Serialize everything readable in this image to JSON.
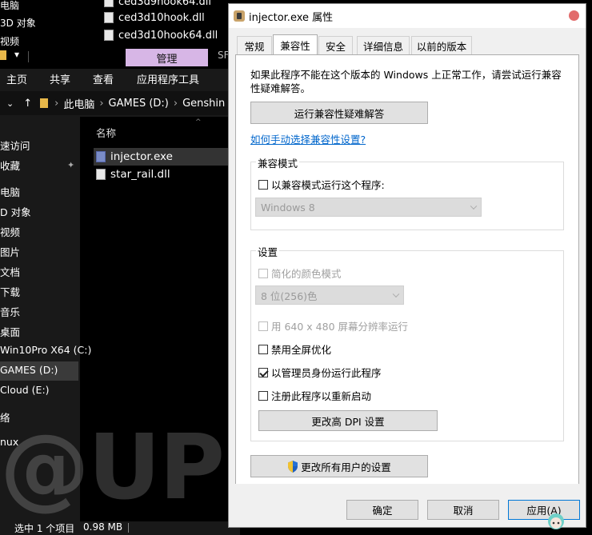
{
  "explorer": {
    "top_files": [
      {
        "name": "ced3d9hook64.dll"
      },
      {
        "name": "ced3d10hook.dll"
      },
      {
        "name": "ced3d10hook64.dll"
      }
    ],
    "top_left_labels": [
      "电脑",
      "3D 对象",
      "视频"
    ],
    "manage_tab": "管理",
    "ribbon": [
      "主页",
      "共享",
      "查看",
      "应用程序工具"
    ],
    "ribbon_edge": "SF",
    "address": {
      "parts": [
        "此电脑",
        "GAMES (D:)",
        "Genshin"
      ]
    },
    "column_name": "名称",
    "nav_items": [
      "速访问",
      "收藏",
      "电脑",
      "D 对象",
      "视频",
      "图片",
      "文档",
      "下载",
      "音乐",
      "桌面",
      "Win10Pro X64 (C:)",
      "GAMES (D:)",
      "Cloud (E:)",
      "络",
      "nux"
    ],
    "files": [
      "injector.exe",
      "star_rail.dll"
    ],
    "status": {
      "selected": "选中 1 个项目",
      "size": "0.98 MB"
    },
    "watermark": "@UP"
  },
  "dialog": {
    "title": "injector.exe 属性",
    "tabs": [
      "常规",
      "兼容性",
      "安全",
      "详细信息",
      "以前的版本"
    ],
    "active_tab": "兼容性",
    "description": "如果此程序不能在这个版本的 Windows 上正常工作，请尝试运行兼容性疑难解答。",
    "troubleshoot_button": "运行兼容性疑难解答",
    "manual_link": "如何手动选择兼容性设置?",
    "compat_mode": {
      "legend": "兼容模式",
      "checkbox_label": "以兼容模式运行这个程序:",
      "checked": false,
      "select_value": "Windows 8"
    },
    "settings": {
      "legend": "设置",
      "reduced_color": {
        "label": "简化的颜色模式",
        "checked": false,
        "disabled": true
      },
      "color_select": "8 位(256)色",
      "res640": {
        "label": "用 640 x 480 屏幕分辨率运行",
        "checked": false,
        "disabled": true
      },
      "disable_fullscreen": {
        "label": "禁用全屏优化",
        "checked": false
      },
      "run_as_admin": {
        "label": "以管理员身份运行此程序",
        "checked": true
      },
      "register_restart": {
        "label": "注册此程序以重新启动",
        "checked": false
      },
      "dpi_button": "更改高 DPI 设置"
    },
    "all_users_button": "更改所有用户的设置",
    "buttons": {
      "ok": "确定",
      "cancel": "取消",
      "apply": "应用(A)"
    }
  },
  "colors": {
    "accent": "#0078d7",
    "manage_tab": "#d7b6e6",
    "link": "#0066cc"
  }
}
